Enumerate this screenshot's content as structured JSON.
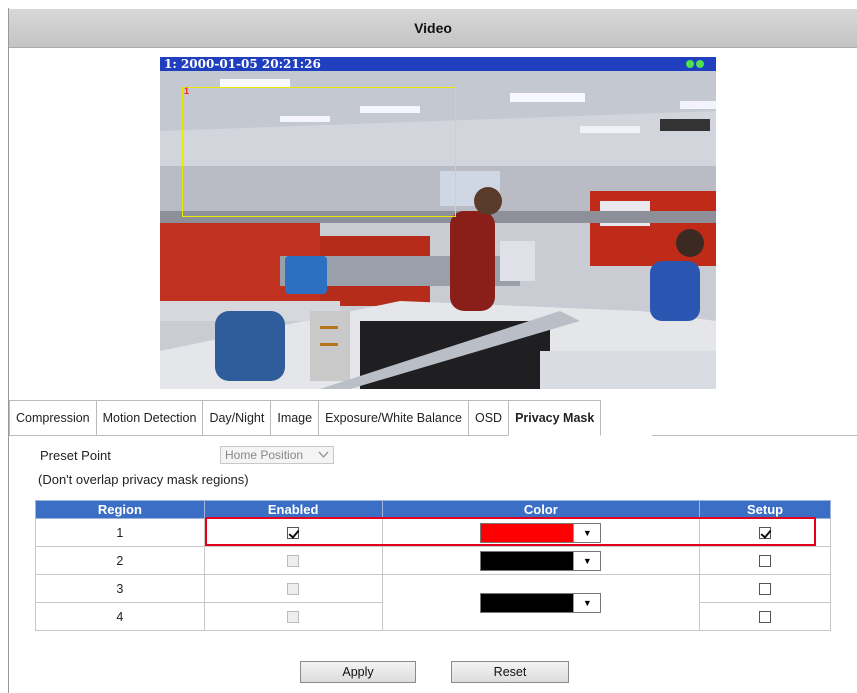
{
  "window": {
    "title": "Video"
  },
  "video": {
    "osd_text": "1:  2000-01-05 20:21:26",
    "mask_label": "1"
  },
  "tabs": [
    {
      "label": "Compression"
    },
    {
      "label": "Motion Detection"
    },
    {
      "label": "Day/Night"
    },
    {
      "label": "Image"
    },
    {
      "label": "Exposure/White Balance"
    },
    {
      "label": "OSD"
    },
    {
      "label": "Privacy Mask",
      "active": true
    }
  ],
  "preset": {
    "label": "Preset Point",
    "selected": "Home Position",
    "note": "(Don't overlap privacy mask regions)"
  },
  "table": {
    "headers": [
      "Region",
      "Enabled",
      "Color",
      "Setup"
    ],
    "rows": [
      {
        "region": "1",
        "enabled": true,
        "color": "#ff0000",
        "setup": true
      },
      {
        "region": "2",
        "enabled": false,
        "color": "#000000",
        "setup": false
      },
      {
        "region": "3",
        "enabled": false,
        "color": "#000000",
        "setup": false
      },
      {
        "region": "4",
        "enabled": false,
        "color": "#000000",
        "setup": false
      }
    ]
  },
  "buttons": {
    "apply": "Apply",
    "reset": "Reset"
  },
  "colors": {
    "header_blue": "#3b6fc6",
    "highlight_red": "#e4001c",
    "osd_blue": "#1f3fbf"
  }
}
